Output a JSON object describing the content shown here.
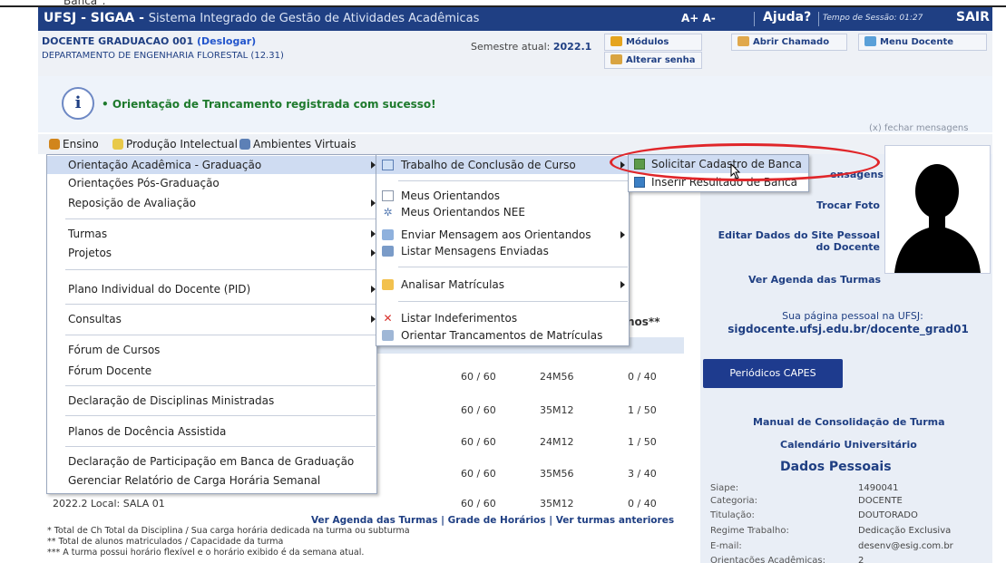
{
  "top_crop_text": "Banca\".",
  "header": {
    "system_name": "UFSJ - SIGAA - ",
    "system_subtitle": "Sistema Integrado de Gestão de Atividades Acadêmicas",
    "font_size_controls": "A+ A-",
    "help_label": "Ajuda?",
    "session_label": "Tempo de Sessão: 01:27",
    "logout_label": "SAIR"
  },
  "info": {
    "user_name": "DOCENTE GRADUACAO 001",
    "logout_link": "(Deslogar)",
    "department": "DEPARTAMENTO DE ENGENHARIA FLORESTAL (12.31)",
    "semester_label": "Semestre atual:",
    "semester_value": "2022.1",
    "modules_label": "Módulos",
    "change_password_label": "Alterar senha",
    "open_ticket_label": "Abrir Chamado",
    "teacher_menu_label": "Menu Docente"
  },
  "message": {
    "icon_letter": "i",
    "text": "• Orientação de Trancamento registrada com sucesso!",
    "close_label": "(x) fechar mensagens"
  },
  "menubar": {
    "ensino": "Ensino",
    "producao": "Produção Intelectual",
    "ambientes": "Ambientes Virtuais"
  },
  "menu_level1": [
    {
      "label": "Orientação Acadêmica - Graduação"
    },
    {
      "label": "Orientações Pós-Graduação"
    },
    {
      "label": "Reposição de Avaliação"
    },
    {
      "label": "Turmas"
    },
    {
      "label": "Projetos"
    },
    {
      "label": "Plano Individual do Docente (PID)"
    },
    {
      "label": "Consultas"
    },
    {
      "label": "Fórum de Cursos"
    },
    {
      "label": "Fórum Docente"
    },
    {
      "label": "Declaração de Disciplinas Ministradas"
    },
    {
      "label": "Planos de Docência Assistida"
    },
    {
      "label": "Declaração de Participação em Banca de Graduação"
    },
    {
      "label": "Gerenciar Relatório de Carga Horária Semanal"
    }
  ],
  "menu_level2": [
    {
      "label": "Trabalho de Conclusão de Curso"
    },
    {
      "label": "Meus Orientandos"
    },
    {
      "label": "Meus Orientandos NEE"
    },
    {
      "label": "Enviar Mensagem aos Orientandos"
    },
    {
      "label": "Listar Mensagens Enviadas"
    },
    {
      "label": "Analisar Matrículas"
    },
    {
      "label": "Listar Indeferimentos"
    },
    {
      "label": "Orientar Trancamentos de Matrículas"
    }
  ],
  "menu_level3": [
    {
      "label": "Solicitar Cadastro de Banca"
    },
    {
      "label": "Inserir Resultado de Banca"
    }
  ],
  "table": {
    "partial_header": "nos**",
    "rows": [
      {
        "ch": "60 / 60",
        "horario": "24M56",
        "alunos": "0 / 40"
      },
      {
        "ch": "60 / 60",
        "horario": "35M12",
        "alunos": "1 / 50"
      },
      {
        "ch": "60 / 60",
        "horario": "24M12",
        "alunos": "1 / 50"
      },
      {
        "ch": "60 / 60",
        "horario": "35M56",
        "alunos": "3 / 40"
      },
      {
        "ch": "60 / 60",
        "horario": "35M12",
        "alunos": "0 / 40"
      }
    ],
    "last_row_label": "2022.2 Local: SALA 01",
    "links": "Ver Agenda das Turmas | Grade de Horários | Ver turmas anteriores",
    "footnote1": "* Total de Ch Total da Disciplina / Sua carga horária dedicada na turma ou subturma",
    "footnote2": "** Total de alunos matriculados / Capacidade da turma",
    "footnote3": "*** A turma possui horário flexível e o horário exibido é da semana atual."
  },
  "sidebar": {
    "messages_partial": "ensagens",
    "change_photo": "Trocar Foto",
    "edit_site": "Editar Dados do Site Pessoal do Docente",
    "agenda": "Ver Agenda das Turmas",
    "personal_page_label": "Sua página pessoal na UFSJ:",
    "personal_page_url": "sigdocente.ufsj.edu.br/docente_grad01",
    "capes_button": "Periódicos CAPES",
    "manual": "Manual de Consolidação de Turma",
    "calendar": "Calendário Universitário",
    "dados_title": "Dados Pessoais",
    "fields": [
      {
        "label": "Siape:",
        "value": "1490041"
      },
      {
        "label": "Categoria:",
        "value": "DOCENTE"
      },
      {
        "label": "Titulação:",
        "value": "DOUTORADO"
      },
      {
        "label": "Regime Trabalho:",
        "value": "Dedicação Exclusiva"
      },
      {
        "label": "E-mail:",
        "value": "desenv@esig.com.br"
      },
      {
        "label": "Orientações Acadêmicas:",
        "value": "2"
      }
    ]
  },
  "colors": {
    "header_bg": "#1f3f83",
    "highlight": "#cfdcf2",
    "annotation_ring": "#e0262a",
    "success_text": "#1e7a2c"
  }
}
